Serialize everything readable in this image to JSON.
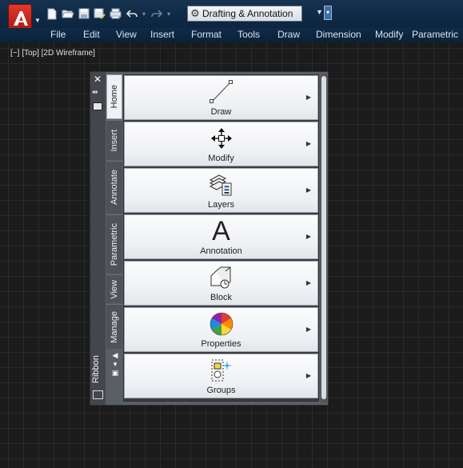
{
  "app": {
    "workspace": "Drafting & Annotation",
    "brand_color": "#c9261b"
  },
  "quick_access": {
    "icons": [
      "new-icon",
      "open-icon",
      "save-icon",
      "save-as-icon",
      "plot-icon",
      "undo-icon",
      "redo-icon"
    ]
  },
  "menubar": {
    "items": [
      "File",
      "Edit",
      "View",
      "Insert",
      "Format",
      "Tools",
      "Draw",
      "Dimension",
      "Modify",
      "Parametric"
    ]
  },
  "viewport": {
    "minus": "[−]",
    "view": "[Top]",
    "style": "[2D Wireframe]"
  },
  "palette": {
    "title": "Ribbon",
    "tabs": [
      "Home",
      "Insert",
      "Annotate",
      "Parametric",
      "View",
      "Manage"
    ],
    "active_tab": "Home",
    "panels": [
      {
        "label": "Draw",
        "icon": "line-icon"
      },
      {
        "label": "Modify",
        "icon": "move-icon"
      },
      {
        "label": "Layers",
        "icon": "layers-icon"
      },
      {
        "label": "Annotation",
        "icon": "text-icon",
        "glyph": "A"
      },
      {
        "label": "Block",
        "icon": "block-icon"
      },
      {
        "label": "Properties",
        "icon": "color-wheel-icon"
      },
      {
        "label": "Groups",
        "icon": "group-icon"
      }
    ]
  }
}
